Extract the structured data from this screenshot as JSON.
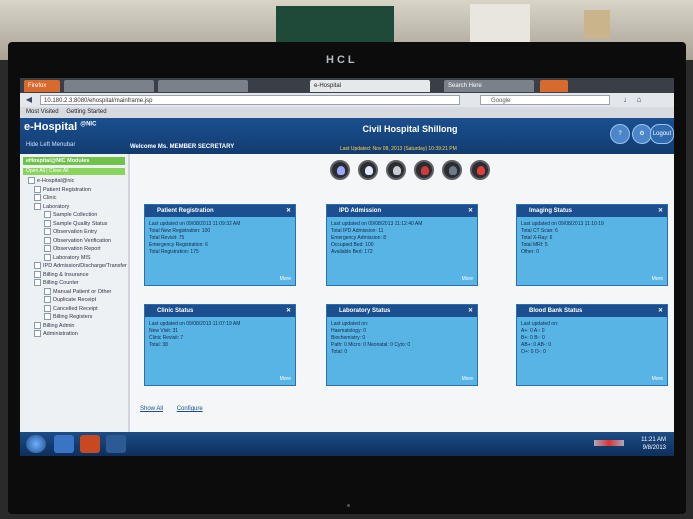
{
  "monitor": {
    "brand": "HCL"
  },
  "browser": {
    "tabs": [
      {
        "label": "Firefox",
        "type": "ff"
      },
      {
        "label": "",
        "type": "plain"
      },
      {
        "label": "",
        "type": "plain"
      },
      {
        "label": "e-Hospital",
        "type": "active"
      },
      {
        "label": "Search Here",
        "type": "plain"
      },
      {
        "label": "",
        "type": "ff"
      }
    ],
    "url": "10.180.2.3:8080/ehospital/mainframe.jsp",
    "search_placeholder": "Google",
    "bookmarks": [
      "Most Visited",
      "Getting Started"
    ]
  },
  "header": {
    "logo": "e-Hospital",
    "logo_sup": "@NIC",
    "hide_link": "Hide Left Menubar",
    "hospital": "Civil Hospital Shillong",
    "welcome": "Welcome Ms. MEMBER SECRETARY",
    "last_updated": "Last Updated: Nov 08, 2013 (Saturday) 10:39:21 PM",
    "icons": [
      "help-icon",
      "settings-icon",
      "logout-icon"
    ],
    "logout_label": "Logout"
  },
  "sidebar": {
    "title": "eHospital@NIC Modules",
    "toggle": "Open All | Close All",
    "tree": [
      {
        "label": "e-Hospital@nic",
        "level": 1
      },
      {
        "label": "Patient Registration",
        "level": 2
      },
      {
        "label": "Clinic",
        "level": 2
      },
      {
        "label": "Laboratory",
        "level": 2
      },
      {
        "label": "Sample Collection",
        "level": 3
      },
      {
        "label": "Sample Quality Status",
        "level": 3
      },
      {
        "label": "Observation Entry",
        "level": 3
      },
      {
        "label": "Observation Verification",
        "level": 3
      },
      {
        "label": "Observation Report",
        "level": 3
      },
      {
        "label": "Laboratory MIS",
        "level": 3
      },
      {
        "label": "IPD Admission/Discharge/Transfer",
        "level": 2
      },
      {
        "label": "Billing & Insurance",
        "level": 2
      },
      {
        "label": "Billing Counter",
        "level": 2
      },
      {
        "label": "Manual Patient or Other",
        "level": 3
      },
      {
        "label": "Duplicate Receipt",
        "level": 3
      },
      {
        "label": "Cancelled Receipt",
        "level": 3
      },
      {
        "label": "Billing Registers",
        "level": 3
      },
      {
        "label": "Billing Admin",
        "level": 2
      },
      {
        "label": "Administration",
        "level": 2
      }
    ]
  },
  "quick_icons": [
    "patient-icon",
    "doctor-icon",
    "lab-icon",
    "blood-icon",
    "device-icon",
    "emergency-icon"
  ],
  "panels": [
    {
      "title": "Patient Registration",
      "lines": [
        "Last updated on 09/08/2013 11:09:32 AM",
        "Total New Registration: 100",
        "Total Revisit: 75",
        "Emergency Registration: 6",
        "Total Registration: 175"
      ],
      "more": "More"
    },
    {
      "title": "IPD Admission",
      "lines": [
        "Last updated on 09/08/2013 11:12:40 AM",
        "Total IPD Admission: 11",
        "Emergency Admission: 8",
        "Occupied Bed: 100",
        "Available Bed: 172"
      ],
      "more": "More"
    },
    {
      "title": "Imaging Status",
      "lines": [
        "Last updated on 09/08/2013 11:10:19",
        "Total CT Scan: 6",
        "Total X-Ray: 6",
        "Total MRI: 5",
        "Other: 0"
      ],
      "more": "More"
    },
    {
      "title": "Clinic Status",
      "lines": [
        "Last updated on 09/08/2013 11:07:19 AM",
        "New Visit: 31",
        "Clinic Revisit: 7",
        "Total: 38"
      ],
      "more": "More"
    },
    {
      "title": "Laboratory Status",
      "lines": [
        "Last updated on:",
        "Haematology: 0",
        "Biochemistry: 0",
        "Path: 0  Micro: 0  Neonatal: 0  Cyto: 0",
        "Total: 0"
      ],
      "more": "More"
    },
    {
      "title": "Blood Bank Status",
      "lines": [
        "Last updated on:",
        "A+: 0  A-: 0",
        "B+: 0  B-: 0",
        "AB+: 0  AB-: 0",
        "O+: 0  O-: 0"
      ],
      "more": "More"
    }
  ],
  "footer_links": {
    "show_all": "Show All",
    "configure": "Configure"
  },
  "taskbar": {
    "time": "11:21 AM",
    "date": "9/8/2013"
  }
}
